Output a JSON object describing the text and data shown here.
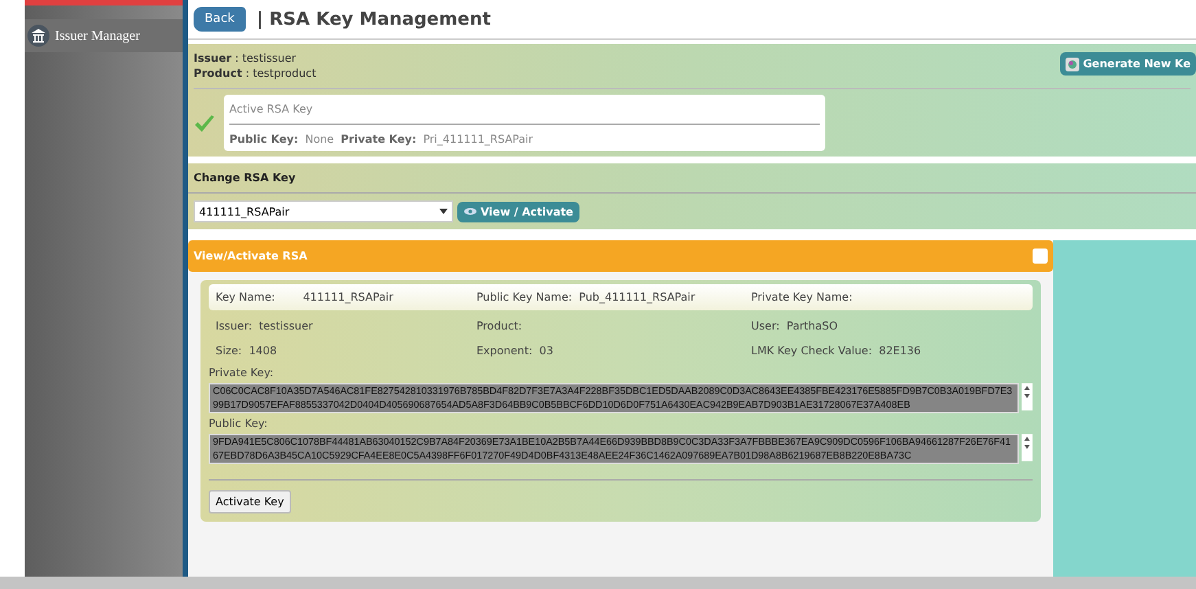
{
  "sidebar": {
    "items": [
      {
        "label": "Issuer Manager",
        "selected": true
      }
    ]
  },
  "header": {
    "back": "Back",
    "title": "| RSA Key Management"
  },
  "info": {
    "issuer": "**Issuer** : testissuer",
    "product": "**Product** : testproduct",
    "generate": "Generate New Ke"
  },
  "active_key": {
    "title": "Active RSA Key",
    "public_label": "Public Key:",
    "public": "None",
    "private_label": "Private Key:",
    "private": "Pri_411111_RSAPair"
  },
  "change": {
    "title": "Change RSA Key",
    "select": "411111_RSAPair",
    "button": "View / Activate"
  },
  "view_panel": {
    "title": "View/Activate RSA",
    "key_name_label": "Key Name:",
    "key_name": "411111_RSAPair",
    "public_name_label": "Public Key Name:",
    "public_name": "Pub_411111_RSAPair",
    "private_name_label": "Private Key Name:",
    "fields": [
      {
        "label": "Issuer:",
        "value": "testissuer"
      },
      {
        "label": "Product:"
      },
      {
        "label": "User:",
        "value": "ParthaSO"
      },
      {
        "label": "Size:",
        "value": "1408"
      },
      {
        "label": "Exponent:",
        "value": "03"
      },
      {
        "label": "LMK Key Check Value:",
        "value": "82E136"
      }
    ],
    "private_key_label": "Private Key:",
    "private_key": "C06C0CAC8F10A35D7A546AC81FE827542810331976B785BD4F82D7F3E7A3A4F228BF35DBC1ED5DAAB2089C0D3AC8643EE4385FBE423176E5885FD9B7C0B3A019BFD7E399B17D9057EFAF8855337042D0404D405690687654AD5A8F3D64BB9C0B5BBCF6DD10D6D0F751A6430EAC942B9EAB7D903B1AE31728067E37A408EB",
    "public_key_label": "Public Key:",
    "public_key": "9FDA941E5C806C1078BF44481AB63040152C9B7A84F20369E73A1BE10A2B5B7A44E66D939BBD8B9C0C3DA33F3A7FBBBE367EA9C909DC0596F106BA94661287F26E76F4167EBD78D6A3B45CA10C5929CFA4EE8E0C5A4398FF6F017270F49D4D0BF4313E48AEE24F36C1462A097689EA7B01D98A8B6219687EB8B220E8BA73C",
    "activate": "Activate Key"
  }
}
